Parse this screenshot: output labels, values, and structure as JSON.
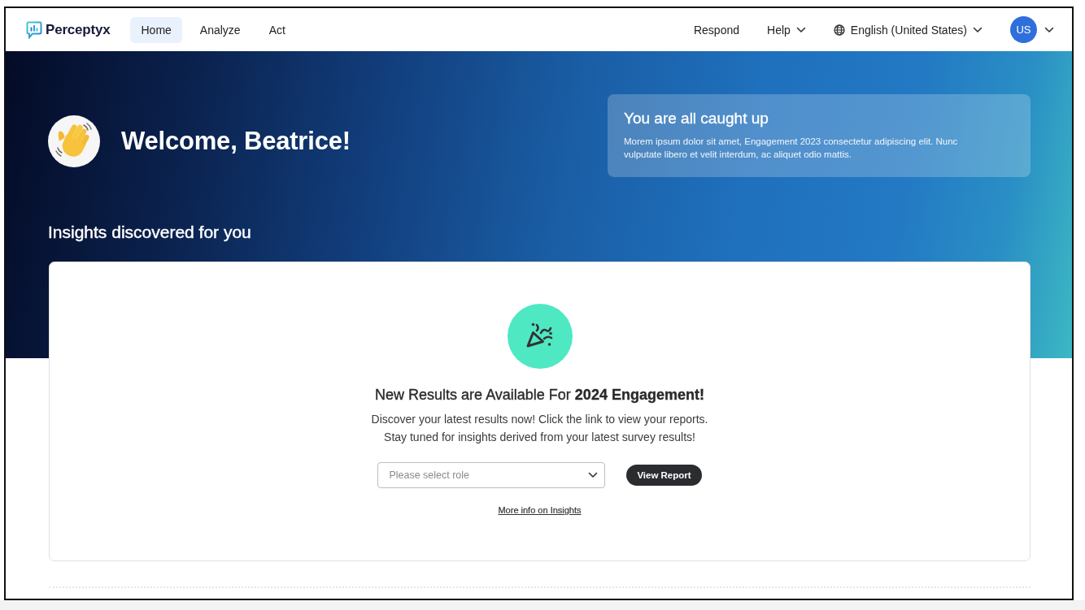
{
  "nav": {
    "logo": "Perceptyx",
    "tabs": [
      {
        "label": "Home",
        "selected": true
      },
      {
        "label": "Analyze",
        "selected": false
      },
      {
        "label": "Act",
        "selected": false
      }
    ],
    "right_items": [
      {
        "label": "Respond",
        "kind": "link"
      },
      {
        "label": "Help",
        "kind": "menu"
      },
      {
        "label": "English (United States)",
        "kind": "language"
      }
    ],
    "avatar": {
      "initials": "US"
    }
  },
  "welcome": {
    "title": "Welcome, Beatrice!"
  },
  "status_card": {
    "title": "You are all caught up",
    "body": "Morem ipsum dolor sit amet, Engagement 2023 consectetur adipiscing elit. Nunc vulputate libero et velit interdum, ac aliquet odio mattis."
  },
  "insights": {
    "heading": "Insights discovered for you",
    "card": {
      "title": "New Results are Available For **2024 Engagement!**",
      "description": [
        "Discover your latest results now! Click the link to view your reports.",
        "Stay tuned for insights derived from your latest survey results!"
      ],
      "role_select": {
        "placeholder": "Please select role"
      },
      "button": "View Report",
      "link": "More info on Insights"
    }
  }
}
